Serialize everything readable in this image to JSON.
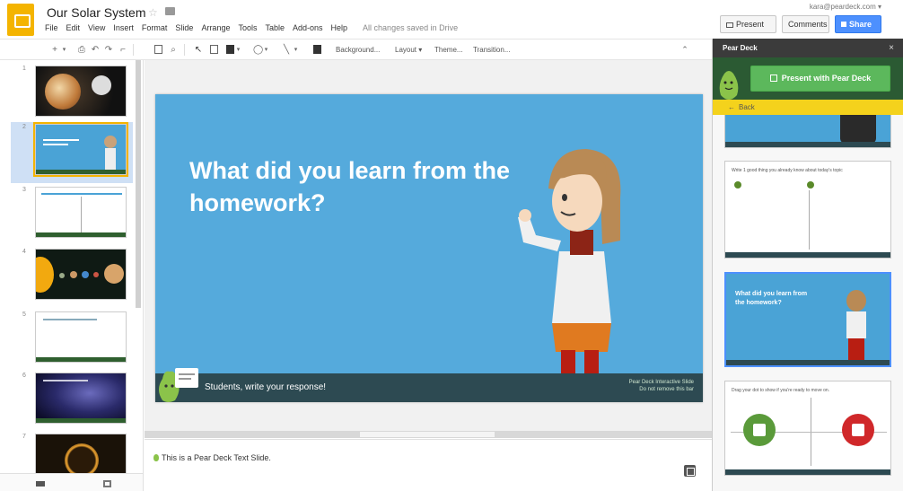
{
  "app": {
    "document_title": "Our Solar System",
    "menu": [
      "File",
      "Edit",
      "View",
      "Insert",
      "Format",
      "Slide",
      "Arrange",
      "Tools",
      "Table",
      "Add-ons",
      "Help"
    ],
    "save_status": "All changes saved in Drive",
    "account_email": "kara@peardeck.com ▾"
  },
  "header_buttons": {
    "present": "Present ▾",
    "comments": "Comments",
    "share": "Share"
  },
  "toolbar": {
    "background": "Background...",
    "layout": "Layout ▾",
    "theme": "Theme...",
    "transition": "Transition..."
  },
  "filmstrip": {
    "slide_numbers": [
      "1",
      "2",
      "3",
      "4",
      "5",
      "6",
      "7"
    ],
    "selected_index": 2
  },
  "slide": {
    "heading": "What did you learn from the homework?",
    "footer_text": "Students, write your response!",
    "footer_note_line1": "Pear Deck Interactive Slide",
    "footer_note_line2": "Do not remove this bar"
  },
  "notes": {
    "text": "This is a Pear Deck Text Slide."
  },
  "panel": {
    "title": "Pear Deck",
    "close": "×",
    "present_button": "Present with Pear Deck",
    "back": "Back",
    "thumb_prompt_1": "Write 1 good thing you already know about today's topic",
    "thumb_heading": "What did you learn from the homework?",
    "thumb_prompt_2": "Drag your dot to show if you're ready to move on."
  },
  "colors": {
    "logo_yellow": "#f4b400",
    "share_blue": "#4d90fe",
    "slide_blue": "#55aadc",
    "pear_green": "#5cb85c",
    "back_yellow": "#f4d21c"
  }
}
